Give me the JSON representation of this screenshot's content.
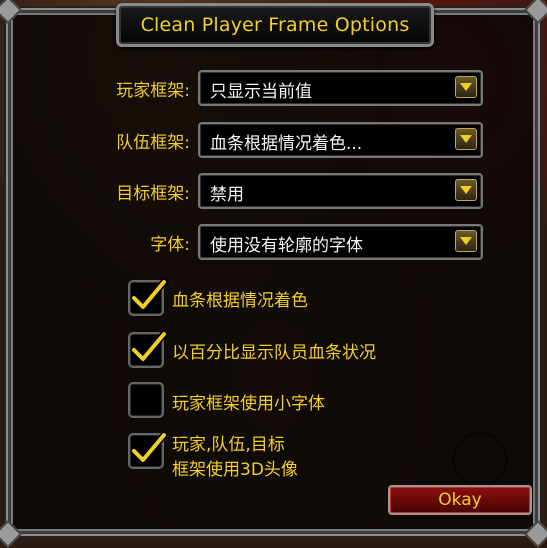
{
  "window": {
    "title": "Clean Player Frame Options"
  },
  "dropdowns": [
    {
      "label": "玩家框架:",
      "value": "只显示当前值"
    },
    {
      "label": "队伍框架:",
      "value": "血条根据情况着色..."
    },
    {
      "label": "目标框架:",
      "value": "禁用"
    },
    {
      "label": "字体:",
      "value": "使用没有轮廓的字体"
    }
  ],
  "checkboxes": [
    {
      "label": "血条根据情况着色",
      "checked": true
    },
    {
      "label": "以百分比显示队员血条状况",
      "checked": true
    },
    {
      "label": "玩家框架使用小字体",
      "checked": false
    },
    {
      "label_line1": "玩家,队伍,目标",
      "label_line2": "框架使用3D头像",
      "checked": true
    }
  ],
  "buttons": {
    "okay_label": "Okay"
  },
  "colors": {
    "label": "#f1cf25",
    "value": "#f4f4f4",
    "okay_bg": "#8c0f0f"
  }
}
